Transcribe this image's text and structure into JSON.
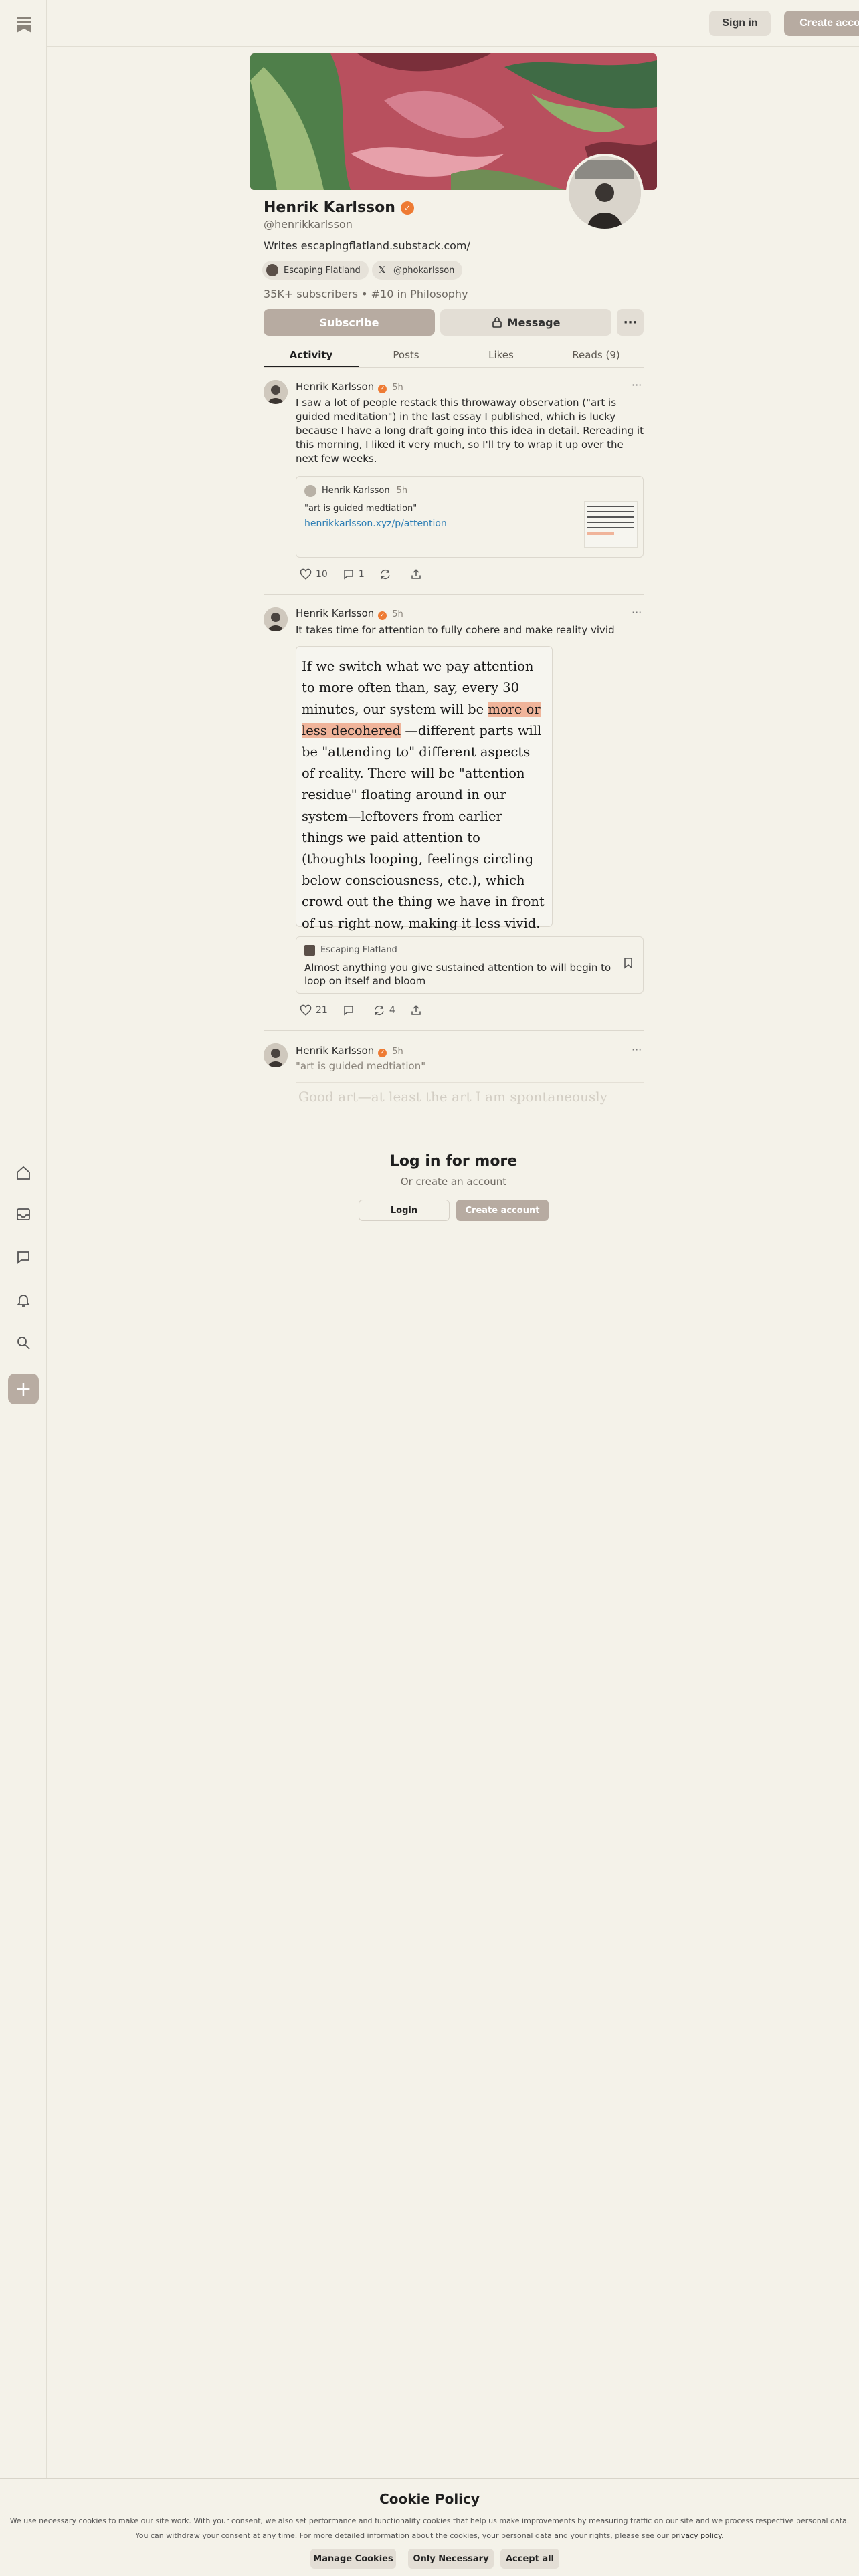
{
  "topbar": {
    "signin": "Sign in",
    "create": "Create account"
  },
  "profile": {
    "name": "Henrik Karlsson",
    "handle": "@henrikkarlsson",
    "bio": "Writes escapingflatland.substack.com/",
    "chips": [
      "Escaping Flatland",
      "@phokarlsson"
    ],
    "stats": "35K+ subscribers  •  #10 in Philosophy",
    "subscribe": "Subscribe",
    "message": "Message",
    "more": "···",
    "tabs": [
      "Activity",
      "Posts",
      "Likes",
      "Reads (9)"
    ]
  },
  "posts": [
    {
      "author": "Henrik Karlsson",
      "time": "5h",
      "text": "I saw a lot of people restack this throwaway observation (\"art is guided meditation\") in the last essay I published, which is lucky because I have a long draft going into this idea in detail. Rereading it this morning, I liked it very much, so I'll try to wrap it up over the next few weeks.",
      "card": {
        "author": "Henrik Karlsson",
        "time": "5h",
        "quote": "\"art is guided medtiation\"",
        "link": "henrikkarlsson.xyz/p/attention"
      },
      "likes": "10",
      "comments": "1"
    },
    {
      "author": "Henrik Karlsson",
      "time": "5h",
      "text": "It takes time for attention to fully cohere and make reality vivid",
      "quote_before": "If we switch what we pay attention to more often than, say, every 30 minutes, our system will be ",
      "quote_highlight": "more or less decohered",
      "quote_after": " —different parts will be \"attending to\" different aspects of reality. There will be \"attention residue\" floating around in our system—leftovers from earlier things we paid attention to (thoughts looping, feelings circling below consciousness, etc.), which crowd out the thing we have in front of us right now, making it less vivid.",
      "card": {
        "pub": "Escaping Flatland",
        "text": "Almost anything you give sustained attention to will begin to loop on itself and bloom"
      },
      "likes": "21",
      "restacks": "4"
    },
    {
      "author": "Henrik Karlsson",
      "time": "5h",
      "text": "\"art is guided medtiation\"",
      "faded": "Good art—at least the art I am spontaneously"
    }
  ],
  "gate": {
    "title": "Log in for more",
    "sub": "Or create an account",
    "login": "Login",
    "create": "Create account"
  },
  "cookie": {
    "title": "Cookie Policy",
    "line1": "We use necessary cookies to make our site work. With your consent, we also set performance and functionality cookies that help us make improvements by measuring traffic on our site and we process respective personal data.",
    "line2": "You can withdraw your consent at any time. For more detailed information about the cookies, your personal data and your rights, please see our",
    "link": "privacy policy",
    "manage": "Manage Cookies",
    "necessary": "Only Necessary",
    "accept": "Accept all"
  },
  "colors": {
    "accent": "#ee7b34",
    "button": "#b7aba1",
    "background": "#f4f2e9",
    "highlight": "#f0b49a"
  }
}
